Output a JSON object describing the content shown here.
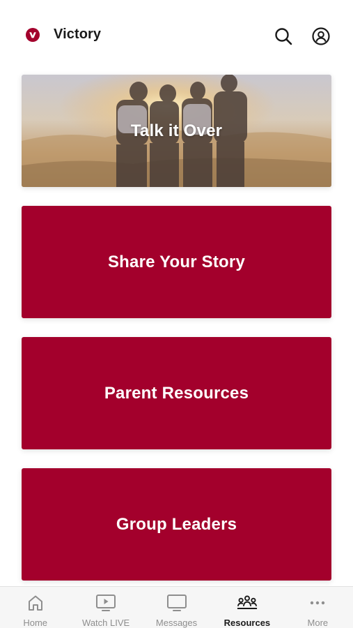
{
  "header": {
    "title": "Victory",
    "logo_icon": "victory-logo-icon",
    "search_icon": "search-icon",
    "profile_icon": "profile-icon"
  },
  "cards": [
    {
      "label": "Talk it Over",
      "style": "photo"
    },
    {
      "label": "Share Your Story",
      "style": "solid"
    },
    {
      "label": "Parent Resources",
      "style": "solid"
    },
    {
      "label": "Group Leaders",
      "style": "solid"
    }
  ],
  "tabs": [
    {
      "label": "Home",
      "icon": "home-icon"
    },
    {
      "label": "Watch LIVE",
      "icon": "play-screen-icon"
    },
    {
      "label": "Messages",
      "icon": "monitor-icon"
    },
    {
      "label": "Resources",
      "icon": "group-icon",
      "active": true
    },
    {
      "label": "More",
      "icon": "more-dots-icon"
    }
  ],
  "colors": {
    "accent": "#a3002c",
    "tab_inactive": "#8e8e8e",
    "tab_active": "#1a1a1a",
    "background": "#ffffff"
  }
}
